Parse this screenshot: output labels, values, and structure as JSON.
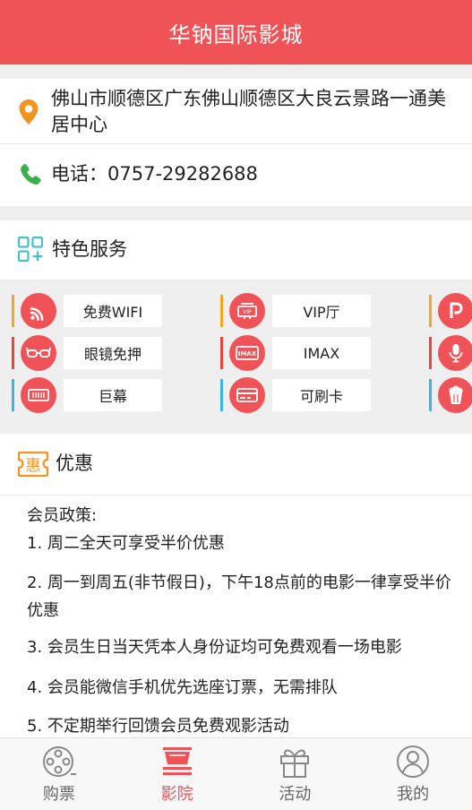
{
  "header": {
    "title": "华钠国际影城"
  },
  "info": {
    "address": "佛山市顺德区广东佛山顺德区大良云景路一通美居中心",
    "phone": "电话：0757-29282688"
  },
  "services": {
    "title": "特色服务",
    "items": [
      {
        "label": "免费WIFI",
        "icon": "wifi-icon",
        "bar_color": "#f5a623"
      },
      {
        "label": "VIP厅",
        "icon": "vip-icon",
        "bar_color": "#f5a623"
      },
      {
        "label": "",
        "icon": "parking-icon",
        "bar_color": "#f5a623"
      },
      {
        "label": "眼镜免押",
        "icon": "glasses-icon",
        "bar_color": "#e8453c"
      },
      {
        "label": "IMAX",
        "icon": "imax-icon",
        "bar_color": "#e8453c"
      },
      {
        "label": "",
        "icon": "microphone-icon",
        "bar_color": "#e8453c"
      },
      {
        "label": "巨幕",
        "icon": "giant-screen-icon",
        "bar_color": "#3bb5e8"
      },
      {
        "label": "可刷卡",
        "icon": "card-icon",
        "bar_color": "#3bb5e8"
      },
      {
        "label": "",
        "icon": "popcorn-icon",
        "bar_color": "#3bb5e8"
      }
    ]
  },
  "promo": {
    "title": "优惠",
    "badge": "惠",
    "policy_title": "会员政策:",
    "policies": [
      "1. 周二全天可享受半价优惠",
      "2. 周一到周五(非节假日)，下午18点前的电影一律享受半价优惠",
      "3. 会员生日当天凭本人身份证均可免费观看一场电影",
      "4. 会员能微信手机优先选座订票，无需排队",
      "5. 不定期举行回馈会员免费观影活动"
    ]
  },
  "tabbar": {
    "tabs": [
      {
        "label": "购票",
        "icon": "film-reel-icon"
      },
      {
        "label": "影院",
        "icon": "cinema-icon",
        "active": true
      },
      {
        "label": "活动",
        "icon": "gift-icon"
      },
      {
        "label": "我的",
        "icon": "user-icon"
      }
    ]
  },
  "colors": {
    "accent": "#f05357",
    "phone_green": "#3bb04a",
    "pin_orange": "#f39322",
    "grid_teal": "#49c0c8"
  }
}
